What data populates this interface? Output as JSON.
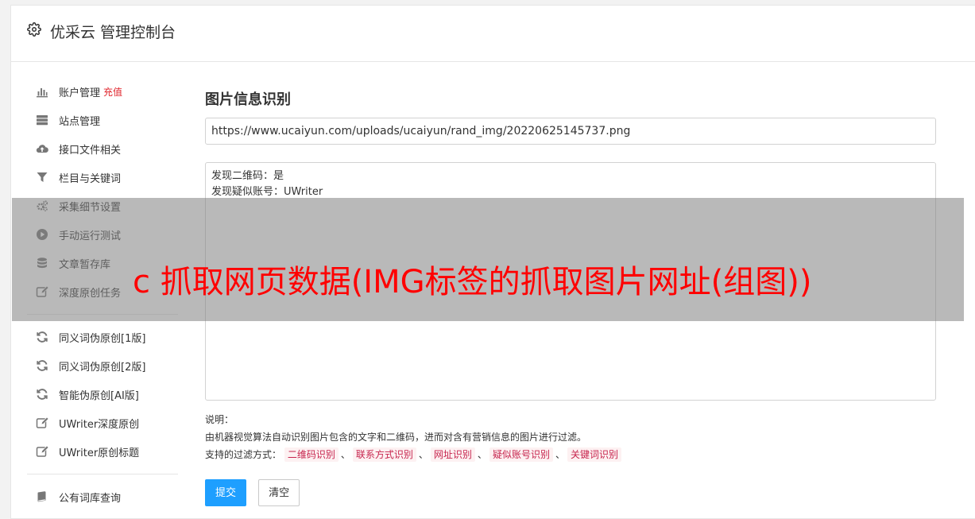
{
  "header": {
    "title": "优采云 管理控制台",
    "icon": "gear-icon"
  },
  "sidebar": {
    "groups": [
      [
        {
          "label": "账户管理",
          "extra": "充值",
          "icon": "bar-chart-icon"
        },
        {
          "label": "站点管理",
          "icon": "server-icon"
        },
        {
          "label": "接口文件相关",
          "icon": "cloud-upload-icon"
        },
        {
          "label": "栏目与关键词",
          "icon": "filter-icon"
        },
        {
          "label": "采集细节设置",
          "icon": "cogs-icon"
        },
        {
          "label": "手动运行测试",
          "icon": "play-circle-icon"
        },
        {
          "label": "文章暂存库",
          "icon": "database-icon"
        },
        {
          "label": "深度原创任务",
          "icon": "edit-icon"
        }
      ],
      [
        {
          "label": "同义词伪原创[1版]",
          "icon": "refresh-icon"
        },
        {
          "label": "同义词伪原创[2版]",
          "icon": "refresh-icon"
        },
        {
          "label": "智能伪原创[AI版]",
          "icon": "refresh-icon"
        },
        {
          "label": "UWriter深度原创",
          "icon": "edit-icon"
        },
        {
          "label": "UWriter原创标题",
          "icon": "edit-icon"
        }
      ],
      [
        {
          "label": "公有词库查询",
          "icon": "book-icon"
        }
      ]
    ]
  },
  "main": {
    "title": "图片信息识别",
    "url_value": "https://www.ucaiyun.com/uploads/ucaiyun/rand_img/20220625145737.png",
    "result_lines": [
      "发现二维码：是",
      "发现疑似账号：UWriter"
    ],
    "desc_label": "说明：",
    "desc_text": "由机器视觉算法自动识别图片包含的文字和二维码，进而对含有营销信息的图片进行过滤。",
    "filter_label": "支持的过滤方式：",
    "filters": [
      "二维码识别",
      "联系方式识别",
      "网址识别",
      "疑似账号识别",
      "关键词识别"
    ],
    "filter_separator": "、",
    "submit_label": "提交",
    "clear_label": "清空"
  },
  "overlay": {
    "text": "c 抓取网页数据(IMG标签的抓取图片网址(组图))"
  },
  "colors": {
    "accent": "#1e9fff",
    "warning": "#e0262d",
    "tag_text": "#c7254e",
    "overlay_text": "#ff0000"
  }
}
